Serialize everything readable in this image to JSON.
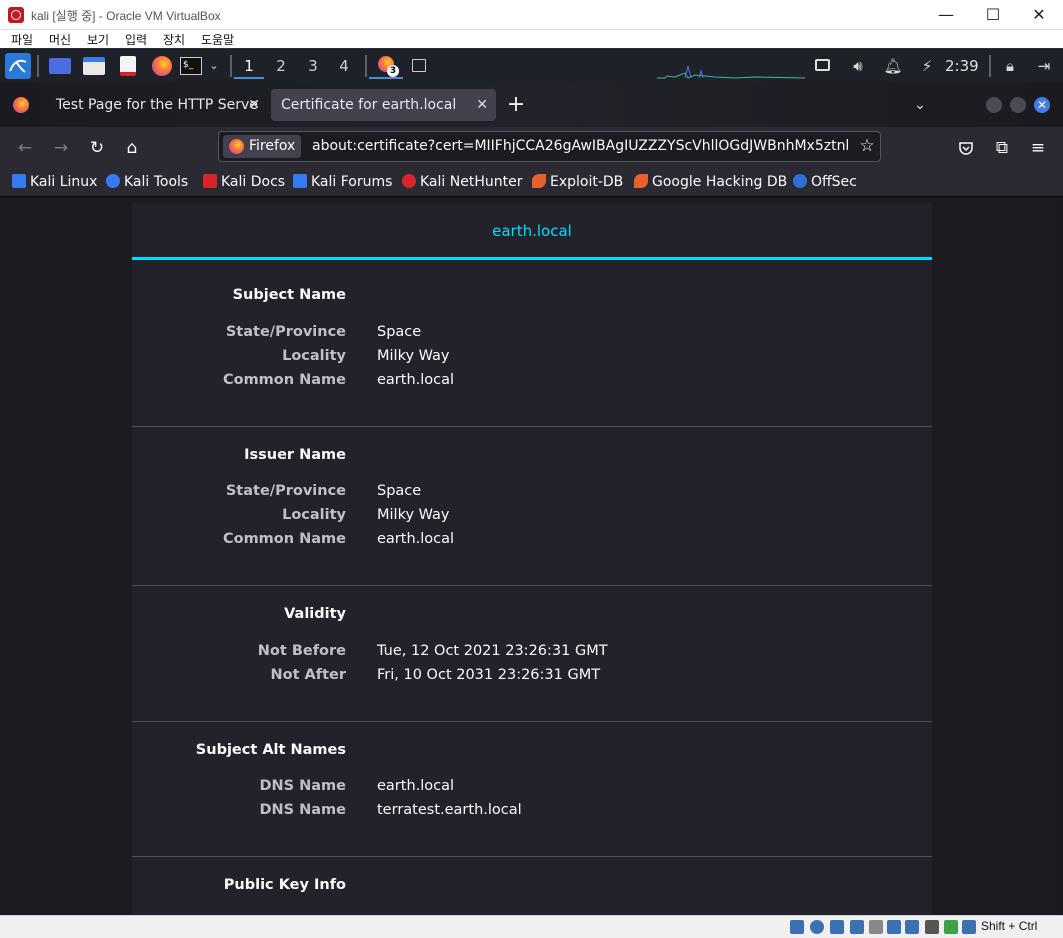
{
  "vbox": {
    "title": "kali [실행 중] - Oracle VM VirtualBox",
    "menu": [
      "파일",
      "머신",
      "보기",
      "입력",
      "장치",
      "도움말"
    ],
    "host_key": "Shift + Ctrl"
  },
  "panel": {
    "workspaces": [
      "1",
      "2",
      "3",
      "4"
    ],
    "firefox_badge": "3",
    "time": "2:39"
  },
  "tabs": [
    {
      "label": "Test Page for the HTTP Serve",
      "close": "✕"
    },
    {
      "label": "Certificate for earth.local",
      "close": "✕"
    }
  ],
  "new_tab": "+",
  "urlbar": {
    "identity": "Firefox",
    "url": "about:certificate?cert=MIIFhjCCA26gAwIBAgIUZZZYScVhllOGdJWBnhMx5ztnl"
  },
  "bookmarks": [
    {
      "label": "Kali Linux",
      "color": "#367bf0"
    },
    {
      "label": "Kali Tools",
      "color": "#367bf0"
    },
    {
      "label": "Kali Docs",
      "color": "#d9242c"
    },
    {
      "label": "Kali Forums",
      "color": "#367bf0"
    },
    {
      "label": "Kali NetHunter",
      "color": "#d9242c"
    },
    {
      "label": "Exploit-DB",
      "color": "#e8612c"
    },
    {
      "label": "Google Hacking DB",
      "color": "#e8612c"
    },
    {
      "label": "OffSec",
      "color": "#2f6fd6"
    }
  ],
  "cert": {
    "tab_title": "earth.local",
    "sections": [
      {
        "title": "Subject Name",
        "rows": [
          {
            "label": "State/Province",
            "value": "Space"
          },
          {
            "label": "Locality",
            "value": "Milky Way"
          },
          {
            "label": "Common Name",
            "value": "earth.local"
          }
        ]
      },
      {
        "title": "Issuer Name",
        "rows": [
          {
            "label": "State/Province",
            "value": "Space"
          },
          {
            "label": "Locality",
            "value": "Milky Way"
          },
          {
            "label": "Common Name",
            "value": "earth.local"
          }
        ]
      },
      {
        "title": "Validity",
        "rows": [
          {
            "label": "Not Before",
            "value": "Tue, 12 Oct 2021 23:26:31 GMT"
          },
          {
            "label": "Not After",
            "value": "Fri, 10 Oct 2031 23:26:31 GMT"
          }
        ]
      },
      {
        "title": "Subject Alt Names",
        "rows": [
          {
            "label": "DNS Name",
            "value": "earth.local"
          },
          {
            "label": "DNS Name",
            "value": "terratest.earth.local"
          }
        ]
      },
      {
        "title": "Public Key Info",
        "rows": []
      }
    ]
  },
  "colors": {
    "accent": "#00ddff",
    "page_bg": "#1c1b22",
    "card_bg": "#23222b"
  }
}
